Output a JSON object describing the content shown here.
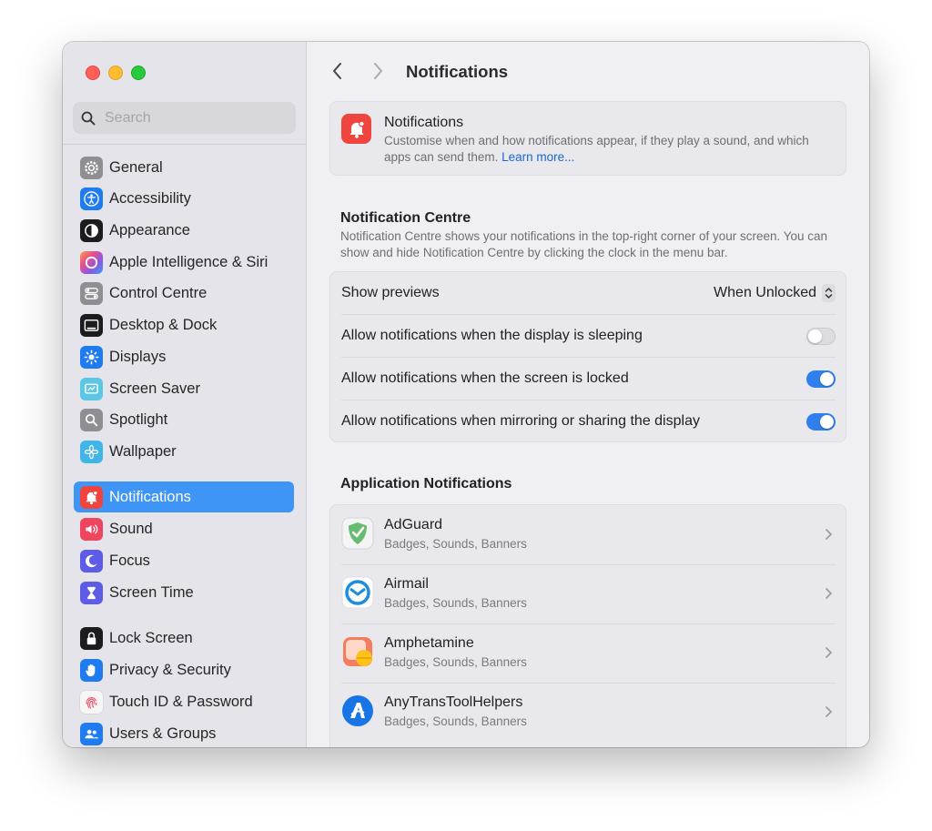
{
  "window": {
    "title": "Notifications"
  },
  "search": {
    "placeholder": "Search"
  },
  "sidebar": {
    "items": [
      {
        "label": "General",
        "icon": "gear-icon",
        "color": "#8e8e93"
      },
      {
        "label": "Accessibility",
        "icon": "accessibility-icon",
        "color": "#1f7cf0"
      },
      {
        "label": "Appearance",
        "icon": "appearance-icon",
        "color": "#1c1c1e"
      },
      {
        "label": "Apple Intelligence & Siri",
        "icon": "siri-icon",
        "color": "#e55c8a"
      },
      {
        "label": "Control Centre",
        "icon": "control-centre-icon",
        "color": "#8e8e93"
      },
      {
        "label": "Desktop & Dock",
        "icon": "desktop-dock-icon",
        "color": "#1c1c1e"
      },
      {
        "label": "Displays",
        "icon": "displays-icon",
        "color": "#1f7cf0"
      },
      {
        "label": "Screen Saver",
        "icon": "screen-saver-icon",
        "color": "#5ac8e5"
      },
      {
        "label": "Spotlight",
        "icon": "spotlight-icon",
        "color": "#8e8e93"
      },
      {
        "label": "Wallpaper",
        "icon": "wallpaper-icon",
        "color": "#3fb5e8"
      },
      {
        "label": "Notifications",
        "icon": "notifications-icon",
        "color": "#f0453f",
        "active": true
      },
      {
        "label": "Sound",
        "icon": "sound-icon",
        "color": "#f0455e"
      },
      {
        "label": "Focus",
        "icon": "focus-icon",
        "color": "#5e5ce6"
      },
      {
        "label": "Screen Time",
        "icon": "screen-time-icon",
        "color": "#5e5ce6"
      },
      {
        "label": "Lock Screen",
        "icon": "lock-icon",
        "color": "#1c1c1e"
      },
      {
        "label": "Privacy & Security",
        "icon": "privacy-hand-icon",
        "color": "#1f7cf0"
      },
      {
        "label": "Touch ID & Password",
        "icon": "fingerprint-icon",
        "color": "#f2f2f2"
      },
      {
        "label": "Users & Groups",
        "icon": "users-icon",
        "color": "#1f7cf0"
      }
    ]
  },
  "header": {
    "title": "Notifications",
    "description": "Customise when and how notifications appear, if they play a sound, and which apps can send them.",
    "link": "Learn more..."
  },
  "notification_centre": {
    "title": "Notification Centre",
    "description": "Notification Centre shows your notifications in the top-right corner of your screen. You can show and hide Notification Centre by clicking the clock in the menu bar.",
    "show_previews_label": "Show previews",
    "show_previews_value": "When Unlocked",
    "toggles": [
      {
        "label": "Allow notifications when the display is sleeping",
        "on": false
      },
      {
        "label": "Allow notifications when the screen is locked",
        "on": true
      },
      {
        "label": "Allow notifications when mirroring or sharing the display",
        "on": true
      }
    ]
  },
  "application_notifications": {
    "title": "Application Notifications",
    "apps": [
      {
        "name": "AdGuard",
        "detail": "Badges, Sounds, Banners",
        "icon": "adguard-icon"
      },
      {
        "name": "Airmail",
        "detail": "Badges, Sounds, Banners",
        "icon": "airmail-icon"
      },
      {
        "name": "Amphetamine",
        "detail": "Badges, Sounds, Banners",
        "icon": "amphetamine-icon"
      },
      {
        "name": "AnyTransToolHelpers",
        "detail": "Badges, Sounds, Banners",
        "icon": "anytrans-icon"
      }
    ]
  }
}
